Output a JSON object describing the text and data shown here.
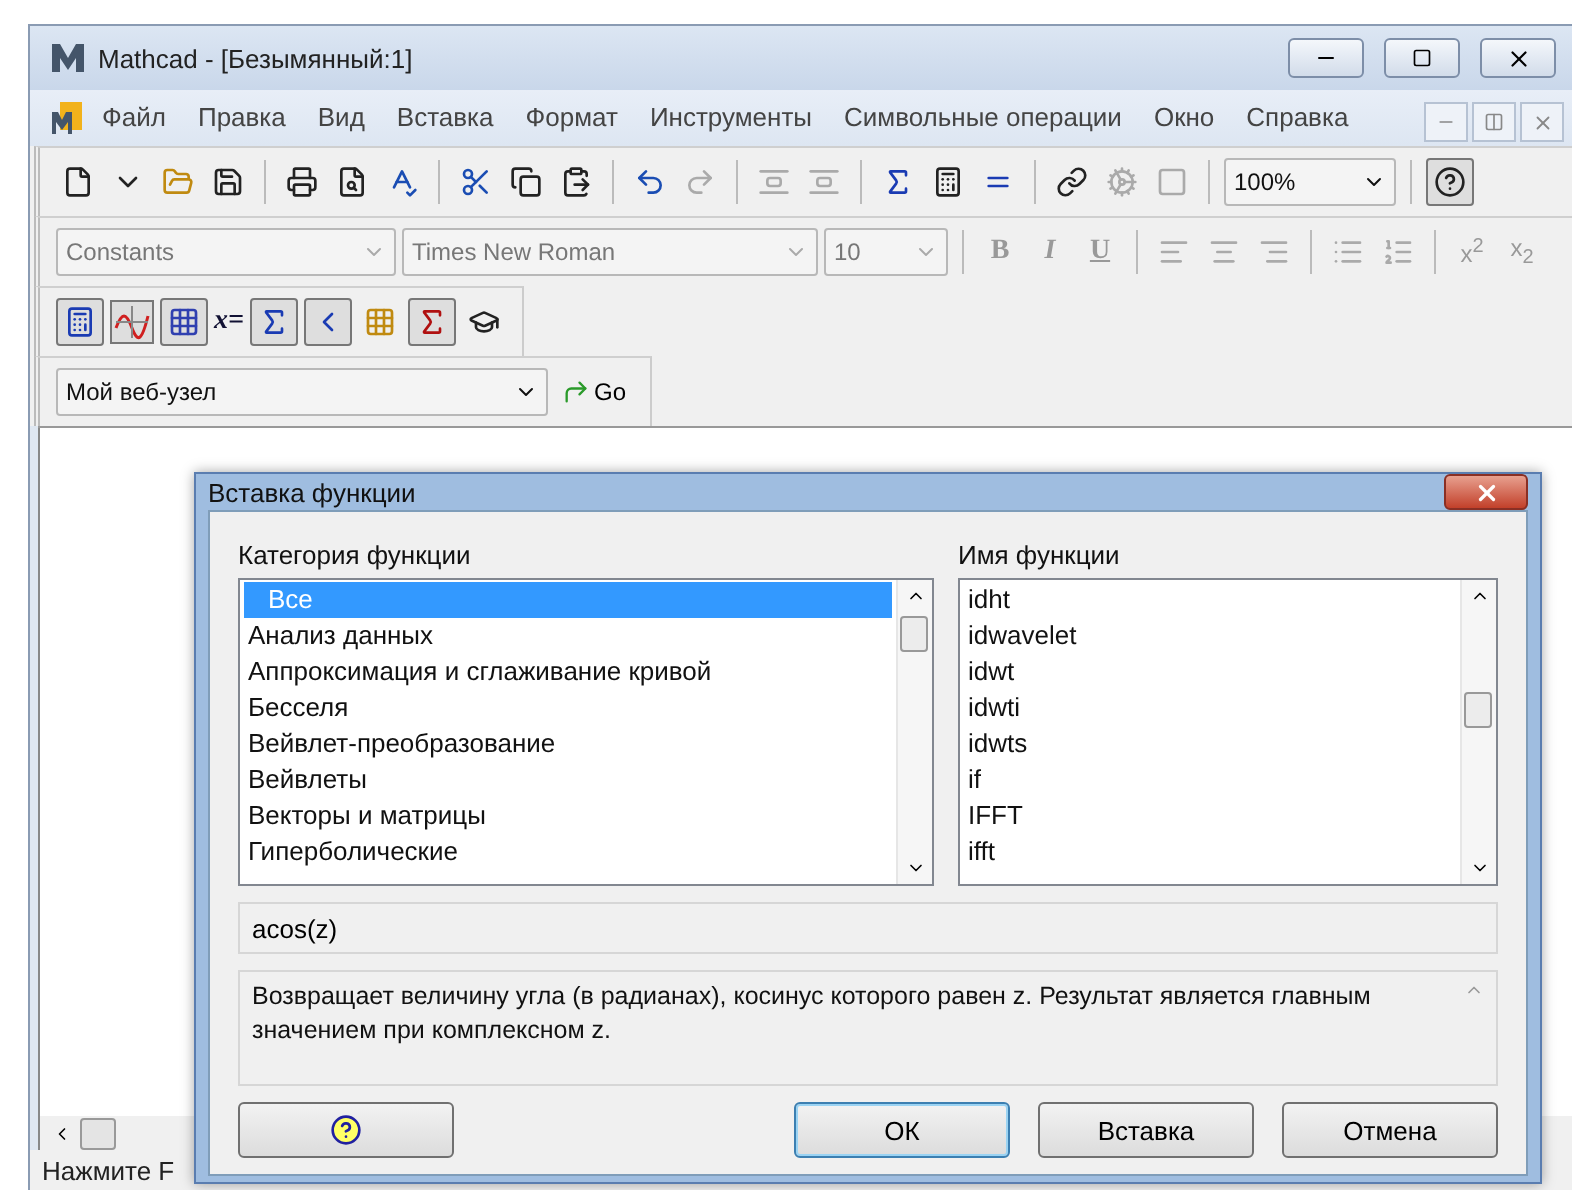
{
  "window": {
    "title": "Mathcad - [Безымянный:1]"
  },
  "menu": [
    "Файл",
    "Правка",
    "Вид",
    "Вставка",
    "Формат",
    "Инструменты",
    "Символьные операции",
    "Окно",
    "Справка"
  ],
  "standard_toolbar": {
    "zoom": "100%"
  },
  "format_toolbar": {
    "style": "Constants",
    "font": "Times New Roman",
    "size": "10",
    "buttons": [
      "B",
      "I",
      "U"
    ],
    "scripts": [
      "x$^{2}$",
      "x$_{2}$"
    ]
  },
  "math_toolbar": {
    "evaluate_label": "x="
  },
  "web_toolbar": {
    "address": "Мой веб-узел",
    "go": "Go"
  },
  "status_bar": "Нажмите F",
  "dialog": {
    "title": "Вставка функции",
    "category_label": "Категория функции",
    "categories": [
      {
        "label": "Все",
        "selected": true
      },
      {
        "label": "Анализ данных",
        "selected": false
      },
      {
        "label": "Аппроксимация и сглаживание кривой",
        "selected": false
      },
      {
        "label": "Бесселя",
        "selected": false
      },
      {
        "label": "Вейвлет-преобразование",
        "selected": false
      },
      {
        "label": "Вейвлеты",
        "selected": false
      },
      {
        "label": "Векторы и матрицы",
        "selected": false
      },
      {
        "label": "Гиперболические",
        "selected": false
      }
    ],
    "name_label": "Имя функции",
    "names": [
      {
        "label": "idht",
        "selected": false
      },
      {
        "label": "idwavelet",
        "selected": false
      },
      {
        "label": "idwt",
        "selected": false
      },
      {
        "label": "idwti",
        "selected": false
      },
      {
        "label": "idwts",
        "selected": false
      },
      {
        "label": "if",
        "selected": false
      },
      {
        "label": "IFFT",
        "selected": false
      },
      {
        "label": "ifft",
        "selected": false
      }
    ],
    "signature": "acos(z)",
    "description": "Возвращает величину угла (в радианах), косинус которого равен z. Результат является главным значением при комплексном z.",
    "buttons": [
      {
        "kind": "help"
      },
      {
        "kind": "text",
        "label": "ОК",
        "default": true
      },
      {
        "kind": "text",
        "label": "Вставка",
        "default": false
      },
      {
        "kind": "text",
        "label": "Отмена",
        "default": false
      }
    ]
  }
}
